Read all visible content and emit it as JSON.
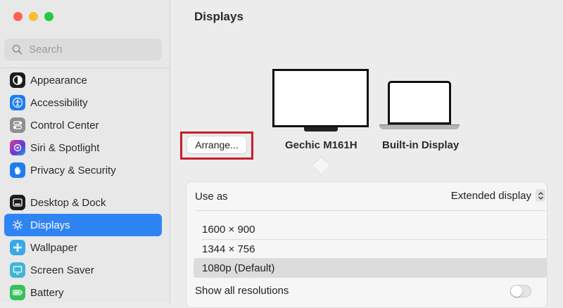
{
  "window": {
    "title": "Displays"
  },
  "sidebar": {
    "search_placeholder": "Search",
    "items": [
      {
        "label": "Appearance",
        "icon": "appearance-icon",
        "color": "#1c1c1c"
      },
      {
        "label": "Accessibility",
        "icon": "accessibility-icon",
        "color": "#1f7cf0"
      },
      {
        "label": "Control Center",
        "icon": "control-center-icon",
        "color": "#8e8e93"
      },
      {
        "label": "Siri & Spotlight",
        "icon": "siri-icon",
        "color": "#9b3bd6"
      },
      {
        "label": "Privacy & Security",
        "icon": "hand-icon",
        "color": "#1f7cf0"
      },
      {
        "label": "Desktop & Dock",
        "icon": "dock-icon",
        "color": "#1c1c1c"
      },
      {
        "label": "Displays",
        "icon": "sun-icon",
        "color": "#2f84f4",
        "selected": true
      },
      {
        "label": "Wallpaper",
        "icon": "wallpaper-icon",
        "color": "#37a9e6"
      },
      {
        "label": "Screen Saver",
        "icon": "screensaver-icon",
        "color": "#3fb5d6"
      },
      {
        "label": "Battery",
        "icon": "battery-icon",
        "color": "#35c25a"
      }
    ]
  },
  "main": {
    "arrange_label": "Arrange...",
    "displays": [
      {
        "name": "Gechic M161H",
        "selected": true
      },
      {
        "name": "Built-in Display"
      }
    ],
    "use_as": {
      "label": "Use as",
      "value": "Extended display"
    },
    "resolutions": [
      {
        "label": "1600 × 900"
      },
      {
        "label": "1344 × 756"
      },
      {
        "label": "1080p (Default)",
        "selected": true
      }
    ],
    "show_all": {
      "label": "Show all resolutions",
      "enabled": false
    }
  }
}
